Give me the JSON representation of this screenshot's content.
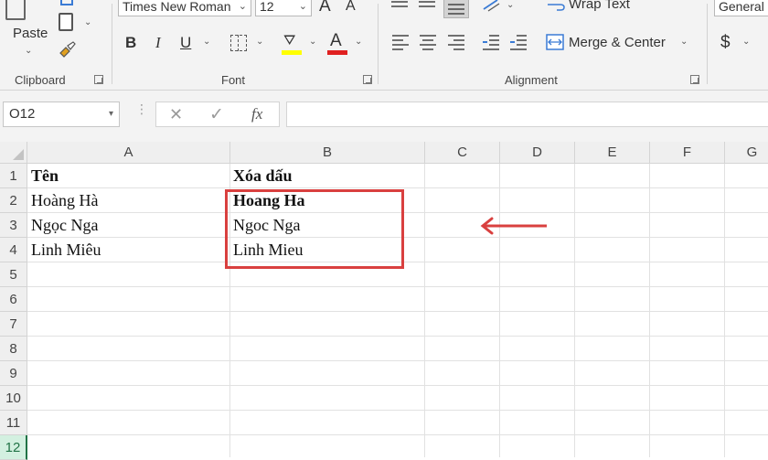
{
  "ribbon": {
    "clipboard": {
      "paste_label": "Paste",
      "group_label": "Clipboard"
    },
    "font": {
      "font_name": "Times New Roman",
      "font_size": "12",
      "bold_label": "B",
      "italic_label": "I",
      "underline_label": "U",
      "grow_label": "A",
      "shrink_label": "A",
      "font_color_label": "A",
      "group_label": "Font",
      "fill_color": "#ffff00",
      "font_color": "#e02020"
    },
    "alignment": {
      "wrap_text_label": "Wrap Text",
      "merge_center_label": "Merge & Center",
      "group_label": "Alignment"
    },
    "number": {
      "format": "General",
      "currency_label": "$"
    }
  },
  "formula_bar": {
    "name_box": "O12",
    "cancel_icon": "✕",
    "enter_icon": "✓",
    "fx_label": "fx",
    "formula": ""
  },
  "columns": [
    "A",
    "B",
    "C",
    "D",
    "E",
    "F",
    "G"
  ],
  "rows": [
    "1",
    "2",
    "3",
    "4",
    "5",
    "6",
    "7",
    "8",
    "9",
    "10",
    "11",
    "12"
  ],
  "cells": {
    "A1": "Tên",
    "B1": "Xóa dấu",
    "A2": "Hoàng Hà",
    "B2": "Hoang Ha",
    "A3": "Ngọc Nga",
    "B3": "Ngoc Nga",
    "A4": "Linh Miêu",
    "B4": "Linh Mieu"
  },
  "annotation": {
    "box_color": "#d9403f",
    "arrow_color": "#d9403f"
  }
}
